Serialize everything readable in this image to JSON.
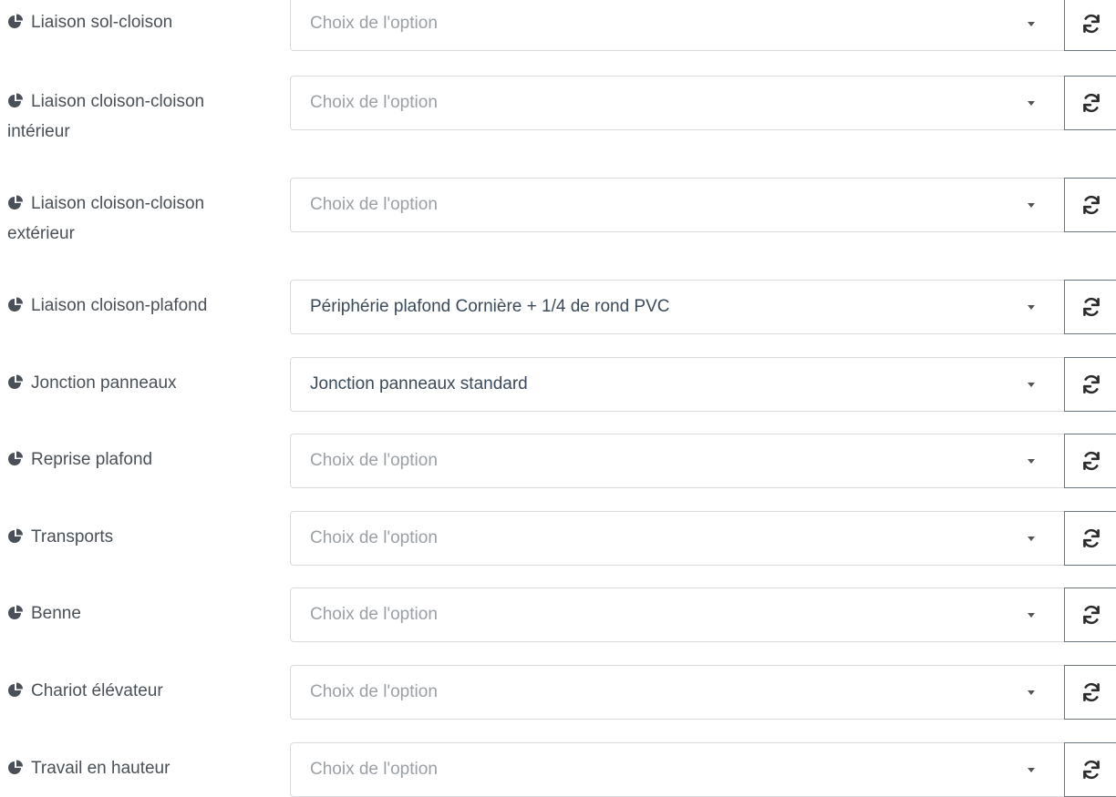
{
  "rows": [
    {
      "label": "Liaison sol-cloison",
      "value": "Choix de l'option",
      "is_placeholder": true
    },
    {
      "label": "Liaison cloison-cloison intérieur",
      "value": "Choix de l'option",
      "is_placeholder": true
    },
    {
      "label": "Liaison cloison-cloison extérieur",
      "value": "Choix de l'option",
      "is_placeholder": true
    },
    {
      "label": "Liaison cloison-plafond",
      "value": "Périphérie plafond Cornière + 1/4 de rond PVC",
      "is_placeholder": false
    },
    {
      "label": "Jonction panneaux",
      "value": "Jonction panneaux standard",
      "is_placeholder": false
    },
    {
      "label": "Reprise plafond",
      "value": "Choix de l'option",
      "is_placeholder": true
    },
    {
      "label": "Transports",
      "value": "Choix de l'option",
      "is_placeholder": true
    },
    {
      "label": "Benne",
      "value": "Choix de l'option",
      "is_placeholder": true
    },
    {
      "label": "Chariot élévateur",
      "value": "Choix de l'option",
      "is_placeholder": true
    },
    {
      "label": "Travail en hauteur",
      "value": "Choix de l'option",
      "is_placeholder": true
    }
  ],
  "icons": {
    "label_icon": "pie-chart-icon",
    "reset_icon": "refresh-icon"
  },
  "colors": {
    "label_text": "#495057",
    "placeholder_text": "#9aa0a6",
    "value_text": "#3b4a5a",
    "input_border": "#d7dbdf",
    "button_border": "#6c757d"
  }
}
